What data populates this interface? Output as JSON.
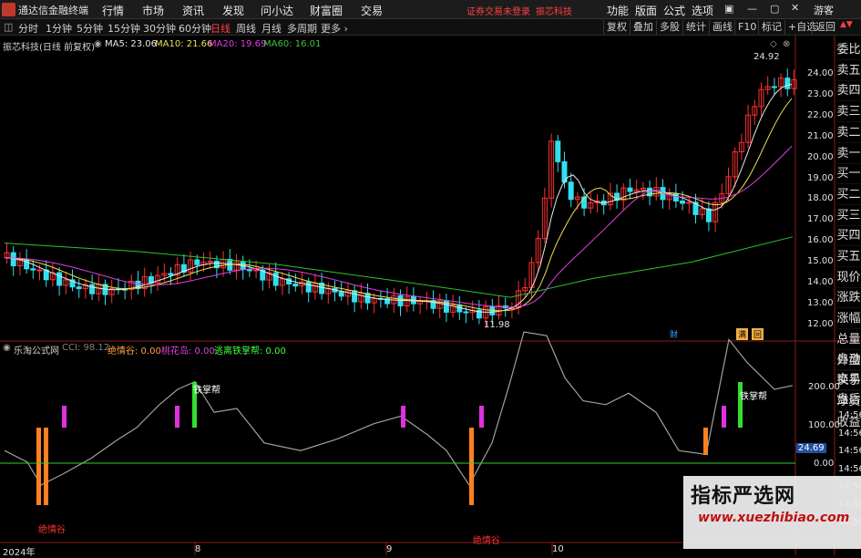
{
  "app": {
    "title": "通达信金融终端",
    "guest": "游客",
    "warning": "证券交易未登录",
    "stock_name_tag": "振芯科技"
  },
  "menu": {
    "items": [
      "行情",
      "市场",
      "资讯",
      "发现",
      "问小达",
      "财富圈",
      "交易"
    ],
    "right": [
      "功能",
      "版面",
      "公式",
      "选项"
    ]
  },
  "periods": {
    "items": [
      "分时",
      "1分钟",
      "5分钟",
      "15分钟",
      "30分钟",
      "60分钟",
      "日线",
      "周线",
      "月线",
      "多周期",
      "更多 ›"
    ],
    "active": "日线"
  },
  "toolbar": {
    "items": [
      "复权",
      "叠加",
      "多股",
      "统计",
      "画线",
      "F10",
      "标记",
      "+自选",
      "返回"
    ]
  },
  "main_panel": {
    "stock": "振芯科技(日线 前复权)",
    "ma": [
      {
        "label": "MA5: 23.06",
        "color": "#e8e8e8"
      },
      {
        "label": "MA10: 21.66",
        "color": "#f0e050"
      },
      {
        "label": "MA20: 19.69",
        "color": "#e040e0"
      },
      {
        "label": "MA60: 16.01",
        "color": "#40c040"
      }
    ],
    "price_axis": [
      "24.00",
      "23.00",
      "22.00",
      "21.00",
      "20.00",
      "19.00",
      "18.00",
      "17.00",
      "16.00",
      "15.00",
      "14.00",
      "13.00",
      "12.00"
    ],
    "high_label": "24.92",
    "low_label": "11.98",
    "markers": [
      "财",
      "满",
      "回"
    ]
  },
  "indicator_panel": {
    "name": "乐淘公式网",
    "values": [
      {
        "label": "CCI: 98.12",
        "color": "#808080"
      },
      {
        "label": "绝情谷: 0.00",
        "color": "#ffa040"
      },
      {
        "label": "桃花岛: 0.00",
        "color": "#e040e0"
      },
      {
        "label": "逃离铁掌帮: 0.00",
        "color": "#40ff40"
      }
    ],
    "axis": [
      "200.00",
      "100.00",
      "0.00"
    ],
    "current": "24.69",
    "annotations": {
      "tiezhang1": "铁掌帮",
      "tiezhang2": "铁掌帮",
      "jueqing1": "绝情谷",
      "jueqing2": "绝情谷"
    }
  },
  "side_panel": {
    "top": [
      "委比",
      "卖五",
      "卖四",
      "卖三",
      "卖二",
      "卖一",
      "买一",
      "买二",
      "买三",
      "买四",
      "买五",
      "现价",
      "涨跌",
      "涨幅",
      "总量",
      "外盘",
      "换手",
      "净资",
      "收益"
    ],
    "bottom": [
      "自动",
      "交易",
      "盘后"
    ],
    "times": [
      "14:56",
      "14:56",
      "14:56",
      "14:56",
      "14:56",
      "14:56",
      "14:56"
    ]
  },
  "x_axis": [
    "2024年",
    "8",
    "9",
    "10"
  ],
  "watermark": {
    "title": "指标严选网",
    "url": "www.xuezhibiao.com"
  }
}
